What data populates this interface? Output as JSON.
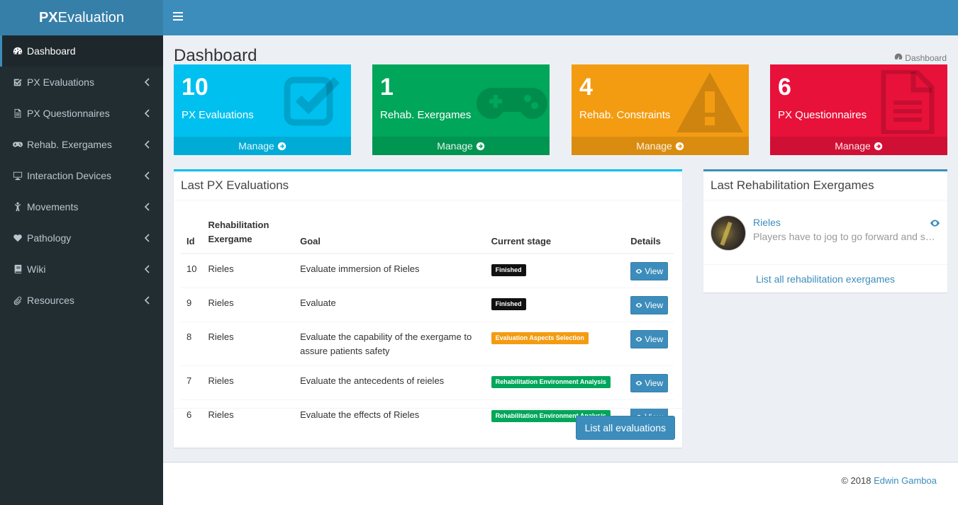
{
  "app": {
    "logo_bold": "PX",
    "logo_rest": "Evaluation"
  },
  "sidebar": {
    "items": [
      {
        "label": "Dashboard",
        "icon": "dashboard-icon"
      },
      {
        "label": "PX Evaluations",
        "icon": "check-square-icon"
      },
      {
        "label": "PX Questionnaires",
        "icon": "file-text-icon"
      },
      {
        "label": "Rehab. Exergames",
        "icon": "gamepad-icon"
      },
      {
        "label": "Interaction Devices",
        "icon": "desktop-icon"
      },
      {
        "label": "Movements",
        "icon": "child-icon"
      },
      {
        "label": "Pathology",
        "icon": "heart-icon"
      },
      {
        "label": "Wiki",
        "icon": "book-icon"
      },
      {
        "label": "Resources",
        "icon": "paperclip-icon"
      }
    ]
  },
  "page": {
    "title": "Dashboard",
    "breadcrumb": "Dashboard"
  },
  "stats": [
    {
      "value": "10",
      "label": "PX Evaluations",
      "footer": "Manage",
      "color": "#00c0ef",
      "icon": "check-square-icon"
    },
    {
      "value": "1",
      "label": "Rehab. Exergames",
      "footer": "Manage",
      "color": "#00a65a",
      "icon": "gamepad-icon"
    },
    {
      "value": "4",
      "label": "Rehab. Constraints",
      "footer": "Manage",
      "color": "#f39c12",
      "icon": "warning-icon"
    },
    {
      "value": "6",
      "label": "PX Questionnaires",
      "footer": "Manage",
      "color": "#dd4b39",
      "icon": "file-text-icon"
    }
  ],
  "evaluations": {
    "title": "Last PX Evaluations",
    "headers": {
      "id": "Id",
      "exergame": "Rehabilitation Exergame",
      "goal": "Goal",
      "stage": "Current stage",
      "details": "Details"
    },
    "rows": [
      {
        "id": "10",
        "exergame": "Rieles",
        "goal": "Evaluate immersion of Rieles",
        "stage": "Finished",
        "stage_color": "#111111",
        "action": "View"
      },
      {
        "id": "9",
        "exergame": "Rieles",
        "goal": "Evaluate",
        "stage": "Finished",
        "stage_color": "#111111",
        "action": "View"
      },
      {
        "id": "8",
        "exergame": "Rieles",
        "goal": "Evaluate the capability of the exergame to assure patients safety",
        "stage": "Evaluation Aspects Selection",
        "stage_color": "#f39c12",
        "action": "View"
      },
      {
        "id": "7",
        "exergame": "Rieles",
        "goal": "Evaluate the antecedents of reieles",
        "stage": "Rehabilitation Environment Analysis",
        "stage_color": "#00a65a",
        "action": "View"
      },
      {
        "id": "6",
        "exergame": "Rieles",
        "goal": "Evaluate the effects of Rieles",
        "stage": "Rehabilitation Environment Analysis",
        "stage_color": "#00a65a",
        "action": "View"
      }
    ],
    "list_button": "List all evaluations"
  },
  "exergames": {
    "title": "Last Rehabilitation Exergames",
    "item": {
      "name": "Rieles",
      "description": "Players have to jog to go forward and squat to avoid obstacles"
    },
    "list_link": "List all rehabilitation exergames"
  },
  "footer": {
    "copyright": "© 2018",
    "author": "Edwin Gamboa"
  }
}
